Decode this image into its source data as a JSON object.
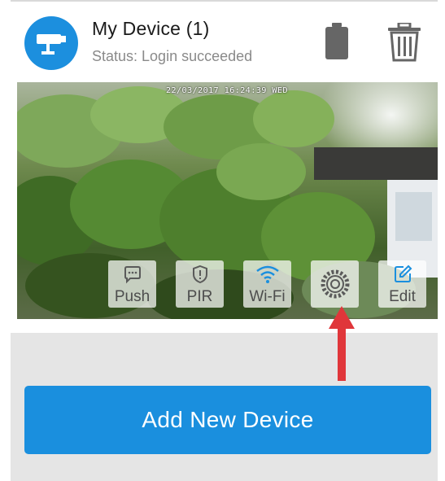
{
  "device": {
    "name": "My Device (1)",
    "status": "Status: Login succeeded",
    "avatar_icon": "camera-icon",
    "battery_icon": "battery-icon",
    "delete_icon": "trash-icon"
  },
  "feed": {
    "timestamp": "22/03/2017 16:24:39 WED",
    "controls": [
      {
        "label": "Push",
        "icon": "chat-bubble-icon"
      },
      {
        "label": "PIR",
        "icon": "shield-alert-icon"
      },
      {
        "label": "Wi-Fi",
        "icon": "wifi-icon"
      },
      {
        "label": "",
        "icon": "gear-icon"
      },
      {
        "label": "Edit",
        "icon": "edit-icon"
      }
    ]
  },
  "actions": {
    "add_label": "Add New Device"
  },
  "colors": {
    "accent": "#1a8fde",
    "annotation_arrow": "#e0363a"
  }
}
